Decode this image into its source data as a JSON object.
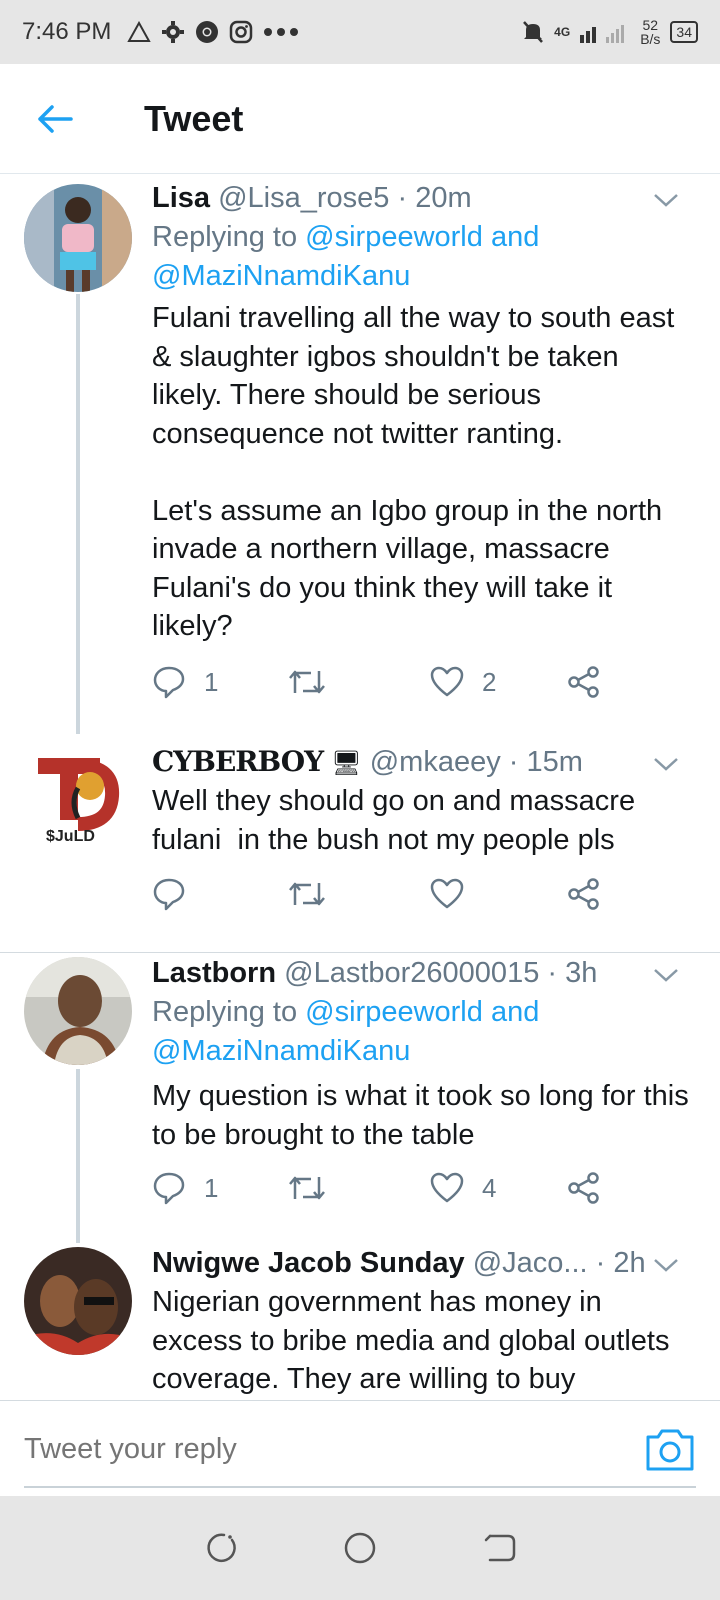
{
  "status_bar": {
    "time": "7:46 PM",
    "icons": [
      "warning-triangle-icon",
      "gear-icon",
      "chrome-icon",
      "instagram-icon",
      "more-dots-icon"
    ],
    "network": "4G",
    "speed_value": "52",
    "speed_unit": "B/s",
    "battery": "34"
  },
  "header": {
    "title": "Tweet"
  },
  "tweets": [
    {
      "name": "Lisa",
      "handle": "@Lisa_rose5",
      "time": "20m",
      "replying_prefix": "Replying to ",
      "replying_mention1": "@sirpeeworld",
      "replying_and": " and",
      "replying_mention2": "@MaziNnamdiKanu",
      "text": "Fulani travelling all the way to south east & slaughter igbos shouldn't be taken likely. There should be serious consequence not twitter ranting.\n\nLet's assume an Igbo group in the north invade a northern village, massacre Fulani's do you think they will take it likely?",
      "replies": "1",
      "retweets": "",
      "likes": "2"
    },
    {
      "name": "CYBERBOY",
      "name_emoji": "🖥",
      "handle": "@mkaeey",
      "time": "15m",
      "avatar_text": "$JuLD",
      "text": "Well they should go on and massacre fulani  in the bush not my people pls",
      "replies": "",
      "retweets": "",
      "likes": ""
    },
    {
      "name": "Lastborn",
      "handle": "@Lastbor26000015",
      "time": "3h",
      "replying_prefix": "Replying to ",
      "replying_mention1": "@sirpeeworld",
      "replying_and": " and",
      "replying_mention2": "@MaziNnamdiKanu",
      "text": "My question is what it took so long for this to be brought to the table",
      "replies": "1",
      "retweets": "",
      "likes": "4"
    },
    {
      "name": "Nwigwe Jacob Sunday",
      "handle": "@Jaco...",
      "time": "2h",
      "text": "Nigerian government has money in excess to bribe media and global outlets coverage. They are willing to buy"
    }
  ],
  "reply_bar": {
    "placeholder": "Tweet your reply"
  },
  "colors": {
    "accent": "#1da1f2",
    "text": "#14171a",
    "muted": "#657786",
    "thread_line": "#ccd6dd"
  }
}
